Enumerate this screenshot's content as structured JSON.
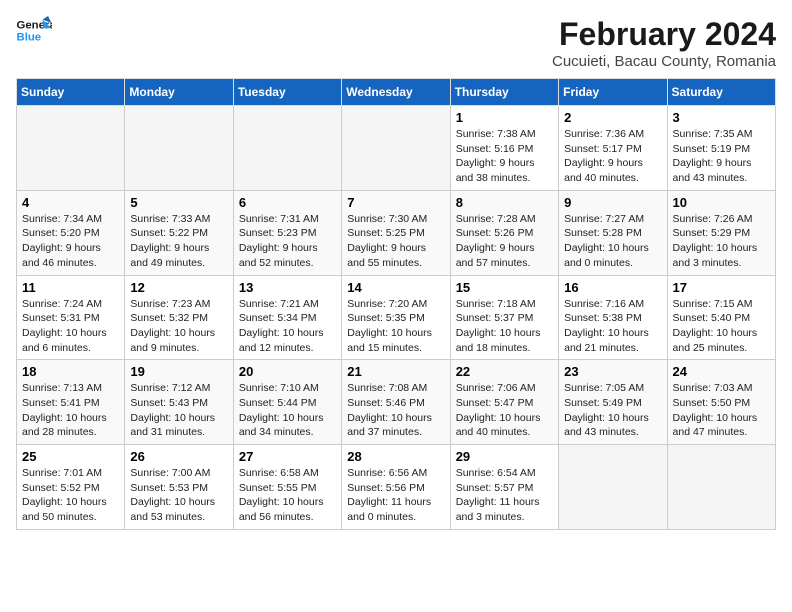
{
  "header": {
    "logo_line1": "General",
    "logo_line2": "Blue",
    "title": "February 2024",
    "subtitle": "Cucuieti, Bacau County, Romania"
  },
  "calendar": {
    "weekdays": [
      "Sunday",
      "Monday",
      "Tuesday",
      "Wednesday",
      "Thursday",
      "Friday",
      "Saturday"
    ],
    "weeks": [
      [
        {
          "day": "",
          "info": ""
        },
        {
          "day": "",
          "info": ""
        },
        {
          "day": "",
          "info": ""
        },
        {
          "day": "",
          "info": ""
        },
        {
          "day": "1",
          "info": "Sunrise: 7:38 AM\nSunset: 5:16 PM\nDaylight: 9 hours\nand 38 minutes."
        },
        {
          "day": "2",
          "info": "Sunrise: 7:36 AM\nSunset: 5:17 PM\nDaylight: 9 hours\nand 40 minutes."
        },
        {
          "day": "3",
          "info": "Sunrise: 7:35 AM\nSunset: 5:19 PM\nDaylight: 9 hours\nand 43 minutes."
        }
      ],
      [
        {
          "day": "4",
          "info": "Sunrise: 7:34 AM\nSunset: 5:20 PM\nDaylight: 9 hours\nand 46 minutes."
        },
        {
          "day": "5",
          "info": "Sunrise: 7:33 AM\nSunset: 5:22 PM\nDaylight: 9 hours\nand 49 minutes."
        },
        {
          "day": "6",
          "info": "Sunrise: 7:31 AM\nSunset: 5:23 PM\nDaylight: 9 hours\nand 52 minutes."
        },
        {
          "day": "7",
          "info": "Sunrise: 7:30 AM\nSunset: 5:25 PM\nDaylight: 9 hours\nand 55 minutes."
        },
        {
          "day": "8",
          "info": "Sunrise: 7:28 AM\nSunset: 5:26 PM\nDaylight: 9 hours\nand 57 minutes."
        },
        {
          "day": "9",
          "info": "Sunrise: 7:27 AM\nSunset: 5:28 PM\nDaylight: 10 hours\nand 0 minutes."
        },
        {
          "day": "10",
          "info": "Sunrise: 7:26 AM\nSunset: 5:29 PM\nDaylight: 10 hours\nand 3 minutes."
        }
      ],
      [
        {
          "day": "11",
          "info": "Sunrise: 7:24 AM\nSunset: 5:31 PM\nDaylight: 10 hours\nand 6 minutes."
        },
        {
          "day": "12",
          "info": "Sunrise: 7:23 AM\nSunset: 5:32 PM\nDaylight: 10 hours\nand 9 minutes."
        },
        {
          "day": "13",
          "info": "Sunrise: 7:21 AM\nSunset: 5:34 PM\nDaylight: 10 hours\nand 12 minutes."
        },
        {
          "day": "14",
          "info": "Sunrise: 7:20 AM\nSunset: 5:35 PM\nDaylight: 10 hours\nand 15 minutes."
        },
        {
          "day": "15",
          "info": "Sunrise: 7:18 AM\nSunset: 5:37 PM\nDaylight: 10 hours\nand 18 minutes."
        },
        {
          "day": "16",
          "info": "Sunrise: 7:16 AM\nSunset: 5:38 PM\nDaylight: 10 hours\nand 21 minutes."
        },
        {
          "day": "17",
          "info": "Sunrise: 7:15 AM\nSunset: 5:40 PM\nDaylight: 10 hours\nand 25 minutes."
        }
      ],
      [
        {
          "day": "18",
          "info": "Sunrise: 7:13 AM\nSunset: 5:41 PM\nDaylight: 10 hours\nand 28 minutes."
        },
        {
          "day": "19",
          "info": "Sunrise: 7:12 AM\nSunset: 5:43 PM\nDaylight: 10 hours\nand 31 minutes."
        },
        {
          "day": "20",
          "info": "Sunrise: 7:10 AM\nSunset: 5:44 PM\nDaylight: 10 hours\nand 34 minutes."
        },
        {
          "day": "21",
          "info": "Sunrise: 7:08 AM\nSunset: 5:46 PM\nDaylight: 10 hours\nand 37 minutes."
        },
        {
          "day": "22",
          "info": "Sunrise: 7:06 AM\nSunset: 5:47 PM\nDaylight: 10 hours\nand 40 minutes."
        },
        {
          "day": "23",
          "info": "Sunrise: 7:05 AM\nSunset: 5:49 PM\nDaylight: 10 hours\nand 43 minutes."
        },
        {
          "day": "24",
          "info": "Sunrise: 7:03 AM\nSunset: 5:50 PM\nDaylight: 10 hours\nand 47 minutes."
        }
      ],
      [
        {
          "day": "25",
          "info": "Sunrise: 7:01 AM\nSunset: 5:52 PM\nDaylight: 10 hours\nand 50 minutes."
        },
        {
          "day": "26",
          "info": "Sunrise: 7:00 AM\nSunset: 5:53 PM\nDaylight: 10 hours\nand 53 minutes."
        },
        {
          "day": "27",
          "info": "Sunrise: 6:58 AM\nSunset: 5:55 PM\nDaylight: 10 hours\nand 56 minutes."
        },
        {
          "day": "28",
          "info": "Sunrise: 6:56 AM\nSunset: 5:56 PM\nDaylight: 11 hours\nand 0 minutes."
        },
        {
          "day": "29",
          "info": "Sunrise: 6:54 AM\nSunset: 5:57 PM\nDaylight: 11 hours\nand 3 minutes."
        },
        {
          "day": "",
          "info": ""
        },
        {
          "day": "",
          "info": ""
        }
      ]
    ]
  }
}
